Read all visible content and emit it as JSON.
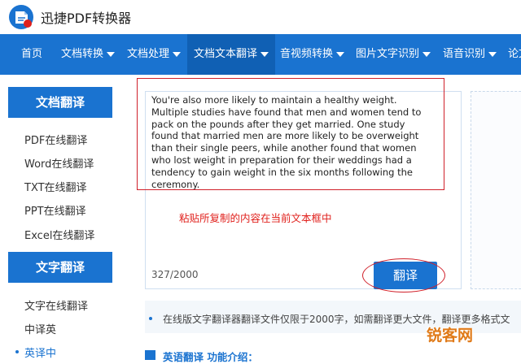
{
  "app": {
    "title": "迅捷PDF转换器"
  },
  "nav": {
    "items": [
      {
        "label": "首页"
      },
      {
        "label": "文档转换"
      },
      {
        "label": "文档处理"
      },
      {
        "label": "文档文本翻译"
      },
      {
        "label": "音视频转换"
      },
      {
        "label": "图片文字识别"
      },
      {
        "label": "语音识别"
      },
      {
        "label": "论文"
      }
    ],
    "active": "文档文本翻译"
  },
  "sidebar": {
    "doc_section": {
      "title": "文档翻译",
      "links": [
        "PDF在线翻译",
        "Word在线翻译",
        "TXT在线翻译",
        "PPT在线翻译",
        "Excel在线翻译"
      ]
    },
    "text_section": {
      "title": "文字翻译",
      "links": [
        "文字在线翻译",
        "中译英",
        "英译中"
      ]
    }
  },
  "editor": {
    "text": "You're also more likely to maintain a healthy weight. Multiple studies have found that men and women tend to pack on the pounds after they get married. One study found that married men are more likely to be overweight than their single peers, while another found that women who lost weight in preparation for their weddings had a tendency to gain weight in the six months following the ceremony.",
    "hint": "粘贴所复制的内容在当前文本框中",
    "counter": "327/2000",
    "translate_label": "翻译"
  },
  "notice": {
    "text": "在线版文字翻译器翻译文件仅限于2000字，如需翻译更大文件，翻译更多格式文"
  },
  "section": {
    "title": "英语翻译 功能介绍："
  },
  "watermark": {
    "text": "锐客网"
  },
  "colors": {
    "brand": "#1a73d0",
    "brand_dark": "#1060b4",
    "annotation": "#d0202a"
  }
}
